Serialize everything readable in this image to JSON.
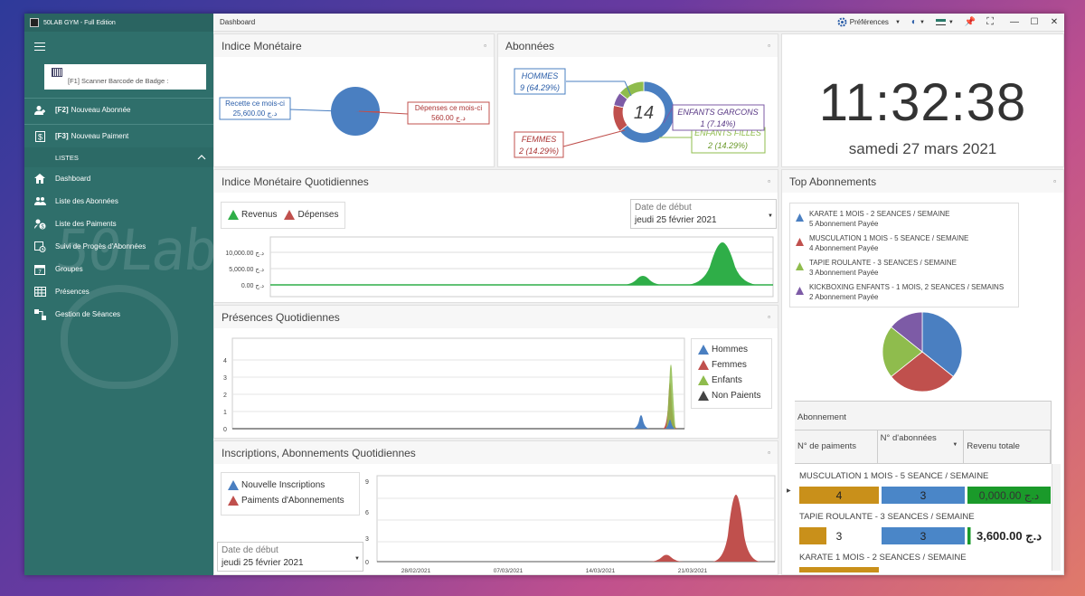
{
  "app": {
    "title": "50LAB GYM - Full Edition"
  },
  "sidebar": {
    "scanner": "[F1] Scanner Barcode de Badge :",
    "actions": [
      {
        "key": "[F2]",
        "label": "Nouveau Abonnée",
        "icon": "add-user-icon"
      },
      {
        "key": "[F3]",
        "label": "Nouveau Paiment",
        "icon": "dollar-icon"
      }
    ],
    "group_label": "LISTES",
    "items": [
      {
        "label": "Dashboard",
        "icon": "home-icon"
      },
      {
        "label": "Liste des Abonnées",
        "icon": "users-icon"
      },
      {
        "label": "Liste des Paiments",
        "icon": "payments-icon"
      },
      {
        "label": "Suivi de Progès d'Abonnées",
        "icon": "progress-icon"
      },
      {
        "label": "Groupes",
        "icon": "calendar-icon"
      },
      {
        "label": "Présences",
        "icon": "attendance-icon"
      },
      {
        "label": "Gestion de Séances",
        "icon": "sessions-icon"
      }
    ],
    "watermark": "50Lab"
  },
  "topbar": {
    "breadcrumb": "Dashboard",
    "preferences": "Préférences"
  },
  "indice_monetaire": {
    "title": "Indice Monétaire",
    "recette_label": "Recette ce mois-ci",
    "recette_value": "25,600.00 د.ج",
    "depenses_label": "Dépenses  ce mois-ci",
    "depenses_value": "560.00 د.ج"
  },
  "abonnees": {
    "title": "Abonnées",
    "total": "14",
    "hommes_label": "HOMMES",
    "hommes_value": "9 (64.29%)",
    "femmes_label": "FEMMES",
    "femmes_value": "2 (14.29%)",
    "garcons_label": "ENFANTS GARCONS",
    "garcons_value": "1 (7.14%)",
    "filles_label": "ENFANTS FILLES",
    "filles_value": "2 (14.29%)"
  },
  "clock": {
    "time": "11:32:38",
    "date": "samedi 27 mars 2021"
  },
  "quotidiennes": {
    "title": "Indice Monétaire Quotidiennes",
    "legend_revenus": "Revenus",
    "legend_depenses": "Dépenses",
    "date_label": "Date de début",
    "date_value": "jeudi 25 février 2021",
    "yticks": [
      "10,000.00 د.ج",
      "5,000.00 د.ج",
      "0.00 د.ج"
    ]
  },
  "presences": {
    "title": "Présences Quotidiennes",
    "legend": [
      "Hommes",
      "Femmes",
      "Enfants",
      "Non Paients"
    ],
    "yticks": [
      "4",
      "3",
      "2",
      "1",
      "0"
    ]
  },
  "inscriptions": {
    "title": "Inscriptions, Abonnements Quotidiennes",
    "legend": [
      "Nouvelle Inscriptions",
      "Paiments d'Abonnements"
    ],
    "date_label": "Date de début",
    "date_value": "jeudi 25 février 2021",
    "yticks": [
      "9",
      "6",
      "3",
      "0"
    ],
    "xticks": [
      "28/02/2021",
      "07/03/2021",
      "14/03/2021",
      "21/03/2021"
    ]
  },
  "top": {
    "title": "Top Abonnements",
    "items": [
      {
        "name": "KARATE 1 MOIS - 2 SEANCES / SEMAINE",
        "sub": "5 Abonnement Payée",
        "color": "#4a7fc1"
      },
      {
        "name": "MUSCULATION 1 MOIS - 5 SEANCE / SEMAINE",
        "sub": "4 Abonnement Payée",
        "color": "#c0504d"
      },
      {
        "name": "TAPIE ROULANTE - 3 SEANCES / SEMAINE",
        "sub": "3 Abonnement Payée",
        "color": "#8fbc4d"
      },
      {
        "name": "KICKBOXING ENFANTS - 1 MOIS, 2 SEANCES / SEMAINS",
        "sub": "2 Abonnement Payée",
        "color": "#7d5ba6"
      }
    ],
    "table": {
      "band": "Abonnement",
      "cols": [
        "N° de paiments",
        "N° d'abonnées",
        "Revenu totale"
      ],
      "rows": [
        {
          "name": "MUSCULATION 1 MOIS - 5 SEANCE / SEMAINE",
          "paiments": "4",
          "abonnees": "3",
          "revenu": "0,000.00 د.ج"
        },
        {
          "name": "TAPIE ROULANTE - 3 SEANCES / SEMAINE",
          "paiments": "3",
          "abonnees": "3",
          "revenu": "3,600.00 د.ج"
        },
        {
          "name": "KARATE 1 MOIS - 2 SEANCES / SEMAINE",
          "paiments": "",
          "abonnees": "",
          "revenu": ""
        }
      ]
    }
  },
  "chart_data": [
    {
      "type": "pie",
      "title": "Indice Monétaire",
      "categories": [
        "Recette ce mois-ci",
        "Dépenses  ce mois-ci"
      ],
      "values": [
        25600,
        560
      ]
    },
    {
      "type": "pie",
      "title": "Abonnées",
      "categories": [
        "HOMMES",
        "FEMMES",
        "ENFANTS GARCONS",
        "ENFANTS FILLES"
      ],
      "values": [
        9,
        2,
        1,
        2
      ]
    },
    {
      "type": "area",
      "title": "Indice Monétaire Quotidiennes",
      "series": [
        {
          "name": "Revenus",
          "x": [
            "2021-03-14",
            "2021-03-22"
          ],
          "values": [
            2500,
            13000
          ]
        },
        {
          "name": "Dépenses",
          "values": [
            0,
            0
          ]
        }
      ],
      "yticks": [
        "10,000.00 د.ج",
        "5,000.00 د.ج",
        "0.00 د.ج"
      ]
    },
    {
      "type": "area",
      "title": "Présences Quotidiennes",
      "series": [
        {
          "name": "Hommes",
          "x": [
            "2021-03-19",
            "2021-03-22"
          ],
          "values": [
            1,
            1
          ]
        },
        {
          "name": "Femmes",
          "x": [
            "2021-03-22"
          ],
          "values": [
            4
          ]
        },
        {
          "name": "Enfants",
          "values": []
        },
        {
          "name": "Non Paients",
          "values": []
        }
      ],
      "ylim": [
        0,
        4
      ]
    },
    {
      "type": "area",
      "title": "Inscriptions, Abonnements Quotidiennes",
      "series": [
        {
          "name": "Nouvelle Inscriptions",
          "values": []
        },
        {
          "name": "Paiments d'Abonnements",
          "x": [
            "2021-03-18",
            "2021-03-26"
          ],
          "values": [
            1,
            9
          ]
        }
      ],
      "ylim": [
        0,
        9
      ],
      "xticks": [
        "28/02/2021",
        "07/03/2021",
        "14/03/2021",
        "21/03/2021"
      ]
    },
    {
      "type": "pie",
      "title": "Top Abonnements",
      "categories": [
        "KARATE 1 MOIS - 2 SEANCES / SEMAINE",
        "MUSCULATION 1 MOIS - 5 SEANCE / SEMAINE",
        "TAPIE ROULANTE - 3 SEANCES / SEMAINE",
        "KICKBOXING ENFANTS - 1 MOIS, 2 SEANCES / SEMAINS"
      ],
      "values": [
        5,
        4,
        3,
        2
      ]
    }
  ]
}
